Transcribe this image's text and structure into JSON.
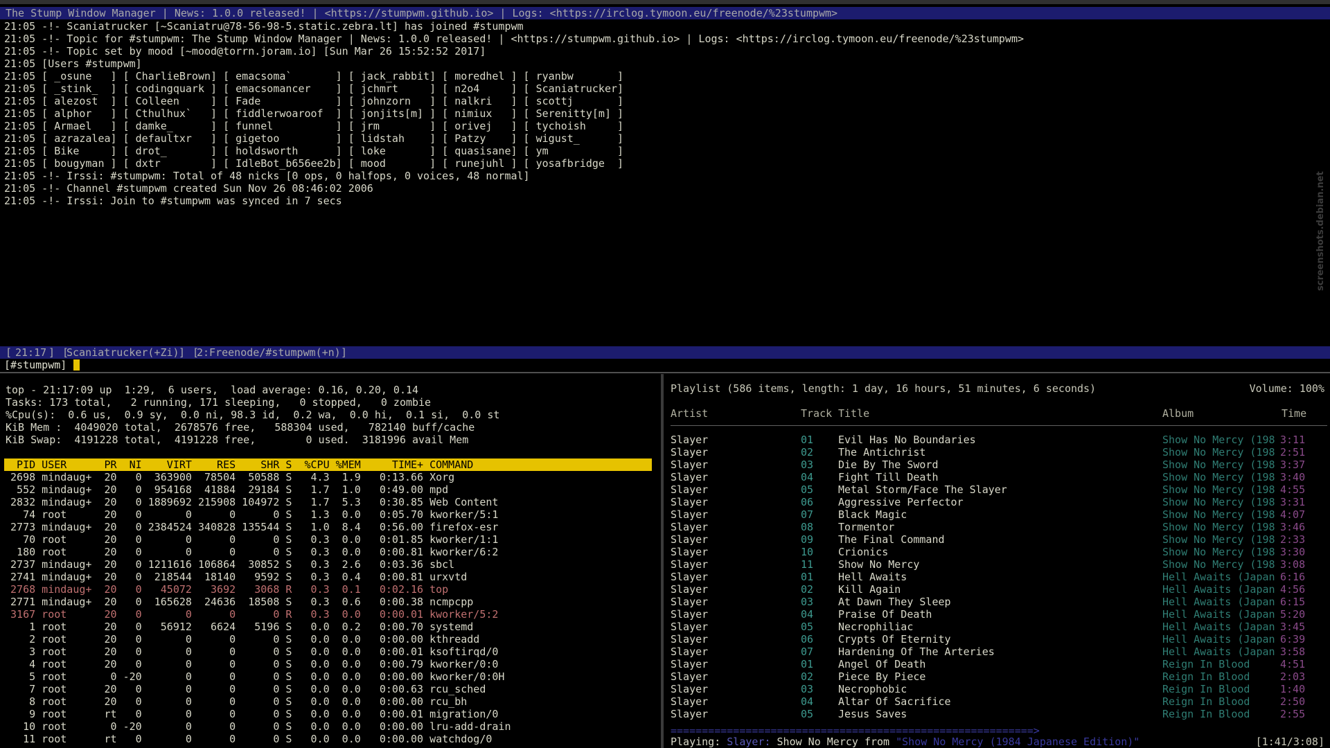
{
  "irc": {
    "topic_bar": "The Stump Window Manager | News: 1.0.0 released! | <https://stumpwm.github.io> | Logs: <https://irclog.tymoon.eu/freenode/%23stumpwm>",
    "lines": [
      "21:05 -!- Scaniatrucker [~Scaniatru@78-56-98-5.static.zebra.lt] has joined #stumpwm",
      "21:05 -!- Topic for #stumpwm: The Stump Window Manager | News: 1.0.0 released! | <https://stumpwm.github.io> | Logs: <https://irclog.tymoon.eu/freenode/%23stumpwm>",
      "21:05 -!- Topic set by mood [~mood@torrn.joram.io] [Sun Mar 26 15:52:52 2017]",
      "21:05 [Users #stumpwm]",
      "21:05 [ _osune   ] [ CharlieBrown] [ emacsoma`       ] [ jack_rabbit] [ moredhel ] [ ryanbw       ]",
      "21:05 [ _stink_  ] [ codingquark ] [ emacsomancer    ] [ jchmrt     ] [ n2o4     ] [ Scaniatrucker]",
      "21:05 [ alezost  ] [ Colleen     ] [ Fade            ] [ johnzorn   ] [ nalkri   ] [ scottj       ]",
      "21:05 [ alphor   ] [ Cthulhux`   ] [ fiddlerwoaroof  ] [ jonjits[m] ] [ nimiux   ] [ Serenitty[m] ]",
      "21:05 [ Armael   ] [ damke_      ] [ funnel          ] [ jrm        ] [ orivej   ] [ tychoish     ]",
      "21:05 [ azrazalea] [ defaultxr   ] [ gigetoo         ] [ lidstah    ] [ Patzy    ] [ wigust_      ]",
      "21:05 [ Bike     ] [ drot_       ] [ holdsworth      ] [ loke       ] [ quasisane] [ ym           ]",
      "21:05 [ bougyman ] [ dxtr        ] [ IdleBot_b656ee2b] [ mood       ] [ runejuhl ] [ yosafbridge  ]",
      "21:05 -!- Irssi: #stumpwm: Total of 48 nicks [0 ops, 0 halfops, 0 voices, 48 normal]",
      "21:05 -!- Channel #stumpwm created Sun Nov 26 08:46:02 2006",
      "21:05 -!- Irssi: Join to #stumpwm was synced in 7 secs"
    ],
    "status": {
      "time": "21:17",
      "nick": "Scaniatrucker(+Zi)",
      "window": "2:Freenode/#stumpwm(+n)"
    },
    "input_prompt": "[#stumpwm]"
  },
  "top": {
    "summary": [
      "top - 21:17:09 up  1:29,  6 users,  load average: 0.16, 0.20, 0.14",
      "Tasks: 173 total,   2 running, 171 sleeping,   0 stopped,   0 zombie",
      "%Cpu(s):  0.6 us,  0.9 sy,  0.0 ni, 98.3 id,  0.2 wa,  0.0 hi,  0.1 si,  0.0 st",
      "KiB Mem :  4049020 total,  2678576 free,   588304 used,   782140 buff/cache",
      "KiB Swap:  4191228 total,  4191228 free,        0 used.  3181996 avail Mem"
    ],
    "header": "  PID USER      PR  NI    VIRT    RES    SHR S  %CPU %MEM     TIME+ COMMAND",
    "processes": [
      {
        "line": " 2698 mindaug+  20   0  363900  78504  50588 S   4.3  1.9   0:13.66 Xorg",
        "state": "S"
      },
      {
        "line": "  552 mindaug+  20   0  954168  41884  29184 S   1.7  1.0   0:49.00 mpd",
        "state": "S"
      },
      {
        "line": " 2832 mindaug+  20   0 1889692 215908 104972 S   1.7  5.3   0:30.85 Web Content",
        "state": "S"
      },
      {
        "line": "   74 root      20   0       0      0      0 S   1.3  0.0   0:05.70 kworker/5:1",
        "state": "S"
      },
      {
        "line": " 2773 mindaug+  20   0 2384524 340828 135544 S   1.0  8.4   0:56.00 firefox-esr",
        "state": "S"
      },
      {
        "line": "   70 root      20   0       0      0      0 S   0.3  0.0   0:01.85 kworker/1:1",
        "state": "S"
      },
      {
        "line": "  180 root      20   0       0      0      0 S   0.3  0.0   0:00.81 kworker/6:2",
        "state": "S"
      },
      {
        "line": " 2737 mindaug+  20   0 1211616 106864  30852 S   0.3  2.6   0:03.36 sbcl",
        "state": "S"
      },
      {
        "line": " 2741 mindaug+  20   0  218544  18140   9592 S   0.3  0.4   0:00.81 urxvtd",
        "state": "S"
      },
      {
        "line": " 2768 mindaug+  20   0   45072   3692   3068 R   0.3  0.1   0:02.16 top",
        "state": "R"
      },
      {
        "line": " 2771 mindaug+  20   0  165628  24636  18508 S   0.3  0.6   0:00.38 ncmpcpp",
        "state": "S"
      },
      {
        "line": " 3167 root      20   0       0      0      0 R   0.3  0.0   0:00.01 kworker/5:2",
        "state": "R"
      },
      {
        "line": "    1 root      20   0   56912   6624   5196 S   0.0  0.2   0:00.70 systemd",
        "state": "S"
      },
      {
        "line": "    2 root      20   0       0      0      0 S   0.0  0.0   0:00.00 kthreadd",
        "state": "S"
      },
      {
        "line": "    3 root      20   0       0      0      0 S   0.0  0.0   0:00.01 ksoftirqd/0",
        "state": "S"
      },
      {
        "line": "    4 root      20   0       0      0      0 S   0.0  0.0   0:00.79 kworker/0:0",
        "state": "S"
      },
      {
        "line": "    5 root       0 -20       0      0      0 S   0.0  0.0   0:00.00 kworker/0:0H",
        "state": "S"
      },
      {
        "line": "    7 root      20   0       0      0      0 S   0.0  0.0   0:00.63 rcu_sched",
        "state": "S"
      },
      {
        "line": "    8 root      20   0       0      0      0 S   0.0  0.0   0:00.00 rcu_bh",
        "state": "S"
      },
      {
        "line": "    9 root      rt   0       0      0      0 S   0.0  0.0   0:00.01 migration/0",
        "state": "S"
      },
      {
        "line": "   10 root       0 -20       0      0      0 S   0.0  0.0   0:00.00 lru-add-drain",
        "state": "S"
      },
      {
        "line": "   11 root      rt   0       0      0      0 S   0.0  0.0   0:00.00 watchdog/0",
        "state": "S"
      }
    ]
  },
  "mpd": {
    "playlist_info": "Playlist (586 items, length: 1 day, 16 hours, 51 minutes, 6 seconds)",
    "volume": "Volume: 100%",
    "columns": {
      "artist": "Artist",
      "track": "Track",
      "title": "Title",
      "album": "Album",
      "time": "Time"
    },
    "rows": [
      {
        "artist": "Slayer",
        "track": "01",
        "title": "Evil Has No Boundaries",
        "album": "Show No Mercy (198",
        "time": "3:11"
      },
      {
        "artist": "Slayer",
        "track": "02",
        "title": "The Antichrist",
        "album": "Show No Mercy (198",
        "time": "2:51"
      },
      {
        "artist": "Slayer",
        "track": "03",
        "title": "Die By The Sword",
        "album": "Show No Mercy (198",
        "time": "3:37"
      },
      {
        "artist": "Slayer",
        "track": "04",
        "title": "Fight Till Death",
        "album": "Show No Mercy (198",
        "time": "3:40"
      },
      {
        "artist": "Slayer",
        "track": "05",
        "title": "Metal Storm/Face The Slayer",
        "album": "Show No Mercy (198",
        "time": "4:55"
      },
      {
        "artist": "Slayer",
        "track": "06",
        "title": "Aggressive Perfector",
        "album": "Show No Mercy (198",
        "time": "3:31"
      },
      {
        "artist": "Slayer",
        "track": "07",
        "title": "Black Magic",
        "album": "Show No Mercy (198",
        "time": "4:07"
      },
      {
        "artist": "Slayer",
        "track": "08",
        "title": "Tormentor",
        "album": "Show No Mercy (198",
        "time": "3:46"
      },
      {
        "artist": "Slayer",
        "track": "09",
        "title": "The Final Command",
        "album": "Show No Mercy (198",
        "time": "2:33"
      },
      {
        "artist": "Slayer",
        "track": "10",
        "title": "Crionics",
        "album": "Show No Mercy (198",
        "time": "3:30"
      },
      {
        "artist": "Slayer",
        "track": "11",
        "title": "Show No Mercy",
        "album": "Show No Mercy (198",
        "time": "3:08"
      },
      {
        "artist": "Slayer",
        "track": "01",
        "title": "Hell Awaits",
        "album": "Hell Awaits (Japan",
        "time": "6:16"
      },
      {
        "artist": "Slayer",
        "track": "02",
        "title": "Kill Again",
        "album": "Hell Awaits (Japan",
        "time": "4:56"
      },
      {
        "artist": "Slayer",
        "track": "03",
        "title": "At Dawn They Sleep",
        "album": "Hell Awaits (Japan",
        "time": "6:15"
      },
      {
        "artist": "Slayer",
        "track": "04",
        "title": "Praise Of Death",
        "album": "Hell Awaits (Japan",
        "time": "5:20"
      },
      {
        "artist": "Slayer",
        "track": "05",
        "title": "Necrophiliac",
        "album": "Hell Awaits (Japan",
        "time": "3:45"
      },
      {
        "artist": "Slayer",
        "track": "06",
        "title": "Crypts Of Eternity",
        "album": "Hell Awaits (Japan",
        "time": "6:39"
      },
      {
        "artist": "Slayer",
        "track": "07",
        "title": "Hardening Of The Arteries",
        "album": "Hell Awaits (Japan",
        "time": "3:58"
      },
      {
        "artist": "Slayer",
        "track": "01",
        "title": "Angel Of Death",
        "album": "Reign In Blood",
        "time": "4:51"
      },
      {
        "artist": "Slayer",
        "track": "02",
        "title": "Piece By Piece",
        "album": "Reign In Blood",
        "time": "2:03"
      },
      {
        "artist": "Slayer",
        "track": "03",
        "title": "Necrophobic",
        "album": "Reign In Blood",
        "time": "1:40"
      },
      {
        "artist": "Slayer",
        "track": "04",
        "title": "Altar Of Sacrifice",
        "album": "Reign In Blood",
        "time": "2:50"
      },
      {
        "artist": "Slayer",
        "track": "05",
        "title": "Jesus Saves",
        "album": "Reign In Blood",
        "time": "2:55"
      }
    ],
    "progress": 0.457,
    "progress_text": "==========================================================>",
    "now_playing": {
      "label": "Playing:",
      "artist": "Slayer:",
      "title": "Show No Mercy",
      "from": "from",
      "album": "\"Show No Mercy (1984 Japanese Edition)\"",
      "position": "[1:41/3:08]"
    }
  },
  "watermark": "screenshots.debian.net",
  "colors": {
    "status_bar_bg": "#1c1c6e",
    "top_header_bg": "#e6c200",
    "teal": "#3d9a8f",
    "background": "#000000"
  }
}
